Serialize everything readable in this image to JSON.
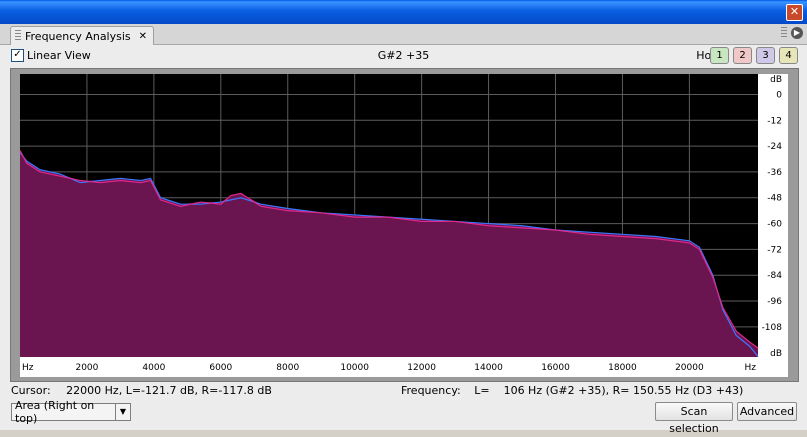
{
  "window": {
    "close_glyph": "✕"
  },
  "tab": {
    "title": "Frequency Analysis",
    "close_glyph": "✕",
    "menu_glyph": "▶"
  },
  "toolbar": {
    "linear_view_label": "Linear View",
    "linear_view_checked": true,
    "check_glyph": "✓",
    "note": "G#2 +35",
    "hold_label": "Hold:",
    "hold_buttons": [
      {
        "label": "1",
        "color": "#c8e6c0"
      },
      {
        "label": "2",
        "color": "#f0c8c8"
      },
      {
        "label": "3",
        "color": "#d0c8e8"
      },
      {
        "label": "4",
        "color": "#e6e6b8"
      }
    ]
  },
  "plot": {
    "y_axis": {
      "unit_label": "dB",
      "ticks": [
        "0",
        "-12",
        "-24",
        "-36",
        "-48",
        "-60",
        "-72",
        "-84",
        "-96",
        "-108"
      ],
      "values": [
        0,
        -12,
        -24,
        -36,
        -48,
        -60,
        -72,
        -84,
        -96,
        -108
      ],
      "range": [
        -122,
        9.5
      ]
    },
    "x_axis": {
      "unit_label": "Hz",
      "ticks": [
        "2000",
        "4000",
        "6000",
        "8000",
        "10000",
        "12000",
        "14000",
        "16000",
        "18000",
        "20000"
      ],
      "values": [
        2000,
        4000,
        6000,
        8000,
        10000,
        12000,
        14000,
        16000,
        18000,
        20000
      ],
      "range": [
        0,
        22050
      ]
    },
    "colors": {
      "background": "#000000",
      "grid": "#5c5c5c",
      "fill": "#6a1450",
      "line_left": "#3c78ff",
      "line_right": "#e0288c",
      "axis_bg": "#ffffff"
    }
  },
  "chart_data": {
    "type": "area",
    "xlabel": "Hz",
    "ylabel": "dB",
    "ylim": [
      -122,
      9.5
    ],
    "xlim": [
      0,
      22050
    ],
    "x": [
      0,
      200,
      600,
      1200,
      1800,
      2400,
      3000,
      3600,
      3900,
      4200,
      4800,
      5400,
      6000,
      6300,
      6600,
      7200,
      8000,
      9000,
      10000,
      11000,
      12000,
      13000,
      14000,
      15000,
      16000,
      17000,
      18000,
      19000,
      20000,
      20300,
      20700,
      21000,
      21400,
      21800,
      22050
    ],
    "series": [
      {
        "name": "L",
        "values": [
          -27,
          -31,
          -35,
          -37,
          -41,
          -40,
          -39,
          -40,
          -39,
          -48,
          -51,
          -51,
          -50,
          -49,
          -48,
          -51,
          -53,
          -55,
          -56,
          -57,
          -58,
          -59,
          -60,
          -61,
          -63,
          -64,
          -65,
          -66,
          -68,
          -71,
          -84,
          -100,
          -112,
          -117,
          -121.7
        ]
      },
      {
        "name": "R",
        "values": [
          -26,
          -32,
          -36,
          -38,
          -40,
          -41,
          -40,
          -41,
          -40,
          -49,
          -52,
          -50,
          -51,
          -47,
          -46,
          -52,
          -54,
          -55,
          -57,
          -57,
          -59,
          -59,
          -61,
          -62,
          -63,
          -65,
          -66,
          -67,
          -69,
          -72,
          -85,
          -99,
          -110,
          -115,
          -117.8
        ]
      }
    ]
  },
  "status": {
    "cursor_label": "Cursor:",
    "cursor_value": "22000 Hz, L=-121.7 dB, R=-117.8 dB",
    "frequency_label": "Frequency:",
    "frequency_value": "L=    106 Hz (G#2 +35), R= 150.55 Hz (D3 +43)"
  },
  "bottom": {
    "area_select": "Area (Right on top)",
    "arrow_glyph": "▼",
    "scan_button": "Scan selection",
    "advanced_button": "Advanced"
  }
}
